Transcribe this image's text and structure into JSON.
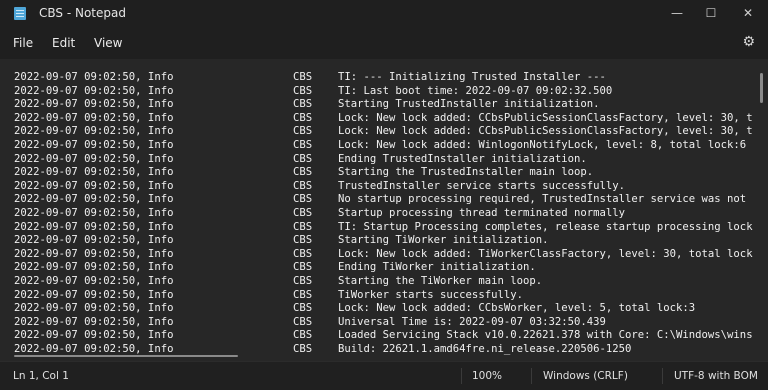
{
  "window": {
    "title": "CBS - Notepad"
  },
  "menu": {
    "file": "File",
    "edit": "Edit",
    "view": "View"
  },
  "log_lines": [
    {
      "date": "2022-09-07 09:02:50, Info",
      "src": "CBS",
      "msg": "TI: --- Initializing Trusted Installer ---"
    },
    {
      "date": "2022-09-07 09:02:50, Info",
      "src": "CBS",
      "msg": "TI: Last boot time: 2022-09-07 09:02:32.500"
    },
    {
      "date": "2022-09-07 09:02:50, Info",
      "src": "CBS",
      "msg": "Starting TrustedInstaller initialization."
    },
    {
      "date": "2022-09-07 09:02:50, Info",
      "src": "CBS",
      "msg": "Lock: New lock added: CCbsPublicSessionClassFactory, level: 30, t"
    },
    {
      "date": "2022-09-07 09:02:50, Info",
      "src": "CBS",
      "msg": "Lock: New lock added: CCbsPublicSessionClassFactory, level: 30, t"
    },
    {
      "date": "2022-09-07 09:02:50, Info",
      "src": "CBS",
      "msg": "Lock: New lock added: WinlogonNotifyLock, level: 8, total lock:6"
    },
    {
      "date": "2022-09-07 09:02:50, Info",
      "src": "CBS",
      "msg": "Ending TrustedInstaller initialization."
    },
    {
      "date": "2022-09-07 09:02:50, Info",
      "src": "CBS",
      "msg": "Starting the TrustedInstaller main loop."
    },
    {
      "date": "2022-09-07 09:02:50, Info",
      "src": "CBS",
      "msg": "TrustedInstaller service starts successfully."
    },
    {
      "date": "2022-09-07 09:02:50, Info",
      "src": "CBS",
      "msg": "No startup processing required, TrustedInstaller service was not"
    },
    {
      "date": "2022-09-07 09:02:50, Info",
      "src": "CBS",
      "msg": "Startup processing thread terminated normally"
    },
    {
      "date": "2022-09-07 09:02:50, Info",
      "src": "CBS",
      "msg": "TI: Startup Processing completes, release startup processing lock"
    },
    {
      "date": "2022-09-07 09:02:50, Info",
      "src": "CBS",
      "msg": "Starting TiWorker initialization."
    },
    {
      "date": "2022-09-07 09:02:50, Info",
      "src": "CBS",
      "msg": "Lock: New lock added: TiWorkerClassFactory, level: 30, total lock"
    },
    {
      "date": "2022-09-07 09:02:50, Info",
      "src": "CBS",
      "msg": "Ending TiWorker initialization."
    },
    {
      "date": "2022-09-07 09:02:50, Info",
      "src": "CBS",
      "msg": "Starting the TiWorker main loop."
    },
    {
      "date": "2022-09-07 09:02:50, Info",
      "src": "CBS",
      "msg": "TiWorker starts successfully."
    },
    {
      "date": "2022-09-07 09:02:50, Info",
      "src": "CBS",
      "msg": "Lock: New lock added: CCbsWorker, level: 5, total lock:3"
    },
    {
      "date": "2022-09-07 09:02:50, Info",
      "src": "CBS",
      "msg": "Universal Time is: 2022-09-07 03:32:50.439"
    },
    {
      "date": "2022-09-07 09:02:50, Info",
      "src": "CBS",
      "msg": "Loaded Servicing Stack v10.0.22621.378 with Core: C:\\Windows\\wins"
    },
    {
      "date": "2022-09-07 09:02:50, Info",
      "src": "CBS",
      "msg": "Build: 22621.1.amd64fre.ni_release.220506-1250"
    }
  ],
  "status": {
    "position": "Ln 1, Col 1",
    "zoom": "100%",
    "line_endings": "Windows (CRLF)",
    "encoding": "UTF-8 with BOM"
  }
}
